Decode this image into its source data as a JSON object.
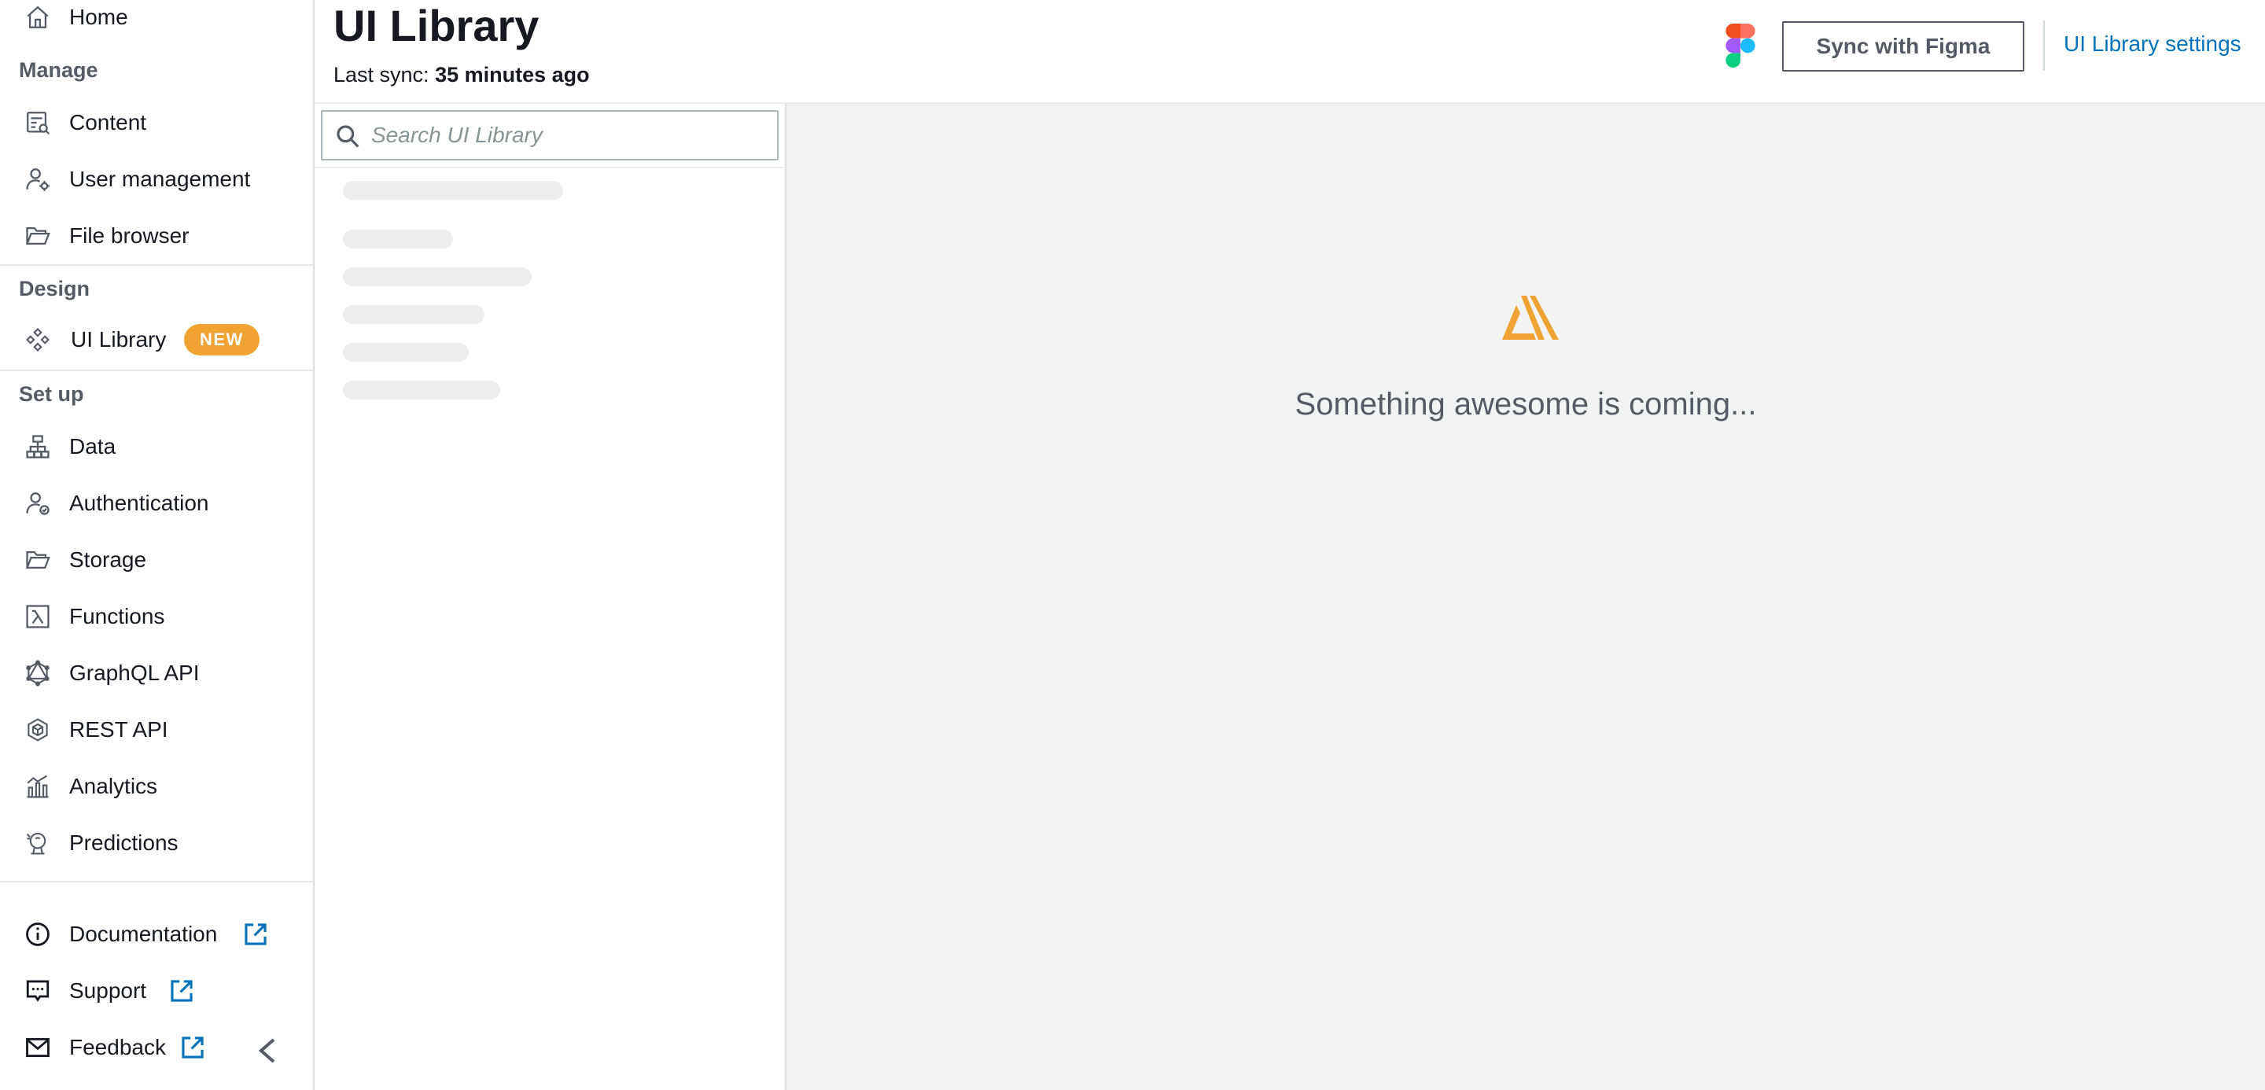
{
  "sidebar": {
    "home_label": "Home",
    "manage": {
      "heading": "Manage",
      "items": [
        {
          "label": "Content",
          "icon": "content-icon"
        },
        {
          "label": "User management",
          "icon": "user-gear-icon"
        },
        {
          "label": "File browser",
          "icon": "folder-icon"
        }
      ]
    },
    "design": {
      "heading": "Design",
      "items": [
        {
          "label": "UI Library",
          "icon": "components-icon",
          "badge": "NEW"
        }
      ]
    },
    "setup": {
      "heading": "Set up",
      "items": [
        {
          "label": "Data",
          "icon": "data-model-icon"
        },
        {
          "label": "Authentication",
          "icon": "user-check-icon"
        },
        {
          "label": "Storage",
          "icon": "folder-icon"
        },
        {
          "label": "Functions",
          "icon": "lambda-icon"
        },
        {
          "label": "GraphQL API",
          "icon": "graphql-icon"
        },
        {
          "label": "REST API",
          "icon": "rest-api-icon"
        },
        {
          "label": "Analytics",
          "icon": "analytics-icon"
        },
        {
          "label": "Predictions",
          "icon": "predictions-icon"
        }
      ]
    },
    "footer": [
      {
        "label": "Documentation",
        "icon": "info-icon"
      },
      {
        "label": "Support",
        "icon": "support-icon"
      },
      {
        "label": "Feedback",
        "icon": "mail-icon"
      }
    ]
  },
  "header": {
    "title": "UI Library",
    "sync_prefix": "Last sync:",
    "sync_value": "35 minutes ago",
    "sync_button": "Sync with Figma",
    "settings_link": "UI Library settings"
  },
  "library": {
    "search_placeholder": "Search UI Library",
    "search_value": ""
  },
  "main": {
    "message": "Something awesome is coming..."
  },
  "colors": {
    "accent_link": "#0073bb",
    "badge": "#f0a233",
    "amplify_orange": "#f0a233",
    "canvas_bg": "#f2f3f3"
  }
}
